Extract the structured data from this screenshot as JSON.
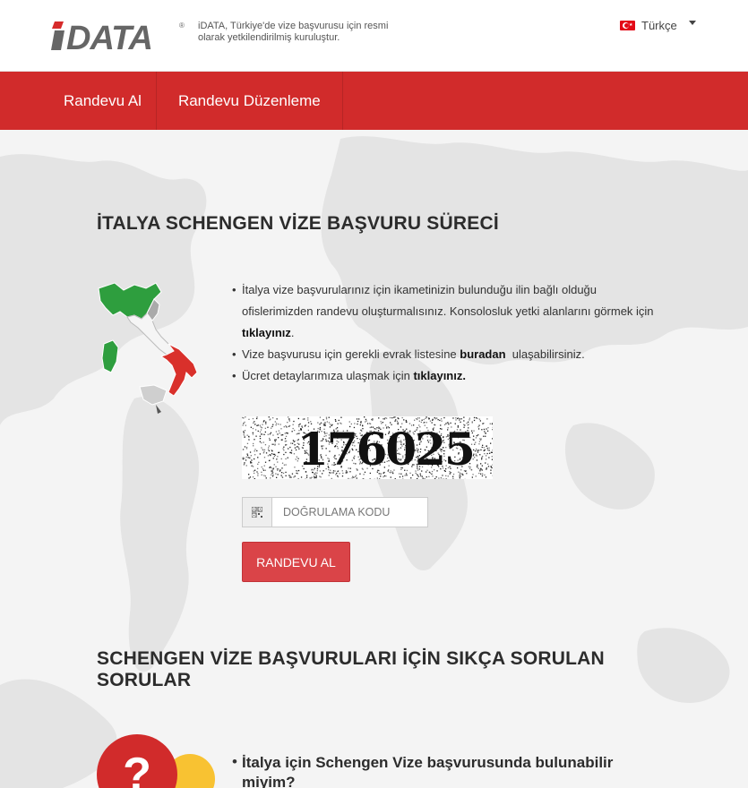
{
  "header": {
    "logo_text": "iDATA",
    "tagline": "iDATA, Türkiye'de vize başvurusu için resmi olarak yetkilendirilmiş kuruluştur.",
    "language": "Türkçe",
    "language_flag_icon": "turkey-flag-icon"
  },
  "nav": {
    "items": [
      {
        "label": "Randevu Al"
      },
      {
        "label": "Randevu Düzenleme"
      }
    ]
  },
  "section1": {
    "title": "İTALYA SCHENGEN VİZE BAŞVURU SÜRECİ",
    "bullets": {
      "b1_text": "İtalya vize başvurularınız için ikametinizin bulunduğu ilin bağlı olduğu ofislerimizden randevu oluşturmalısınız. Konsolosluk yetki alanlarını görmek için ",
      "b1_link": "tıklayınız",
      "b1_end": ".",
      "b2_text": "Vize başvurusu için gerekli evrak listesine ",
      "b2_link": "buradan",
      "b2_end": "  ulaşabilirsiniz.",
      "b3_text": "Ücret detaylarımıza ulaşmak için ",
      "b3_link": "tıklayınız."
    },
    "captcha_value": "176025",
    "verification_placeholder": "DOĞRULAMA KODU",
    "verification_value": "",
    "submit_label": "RANDEVU AL"
  },
  "section2": {
    "title": "SCHENGEN VİZE BAŞVURULARI İÇİN SIKÇA SORULAN SORULAR",
    "faq_question": "İtalya için Schengen Vize başvurusunda bulunabilir miyim?"
  },
  "colors": {
    "brand_red": "#d12b2b",
    "button_red": "#da4448",
    "italy_green": "#2e9e3e",
    "italy_red": "#d9302b"
  }
}
